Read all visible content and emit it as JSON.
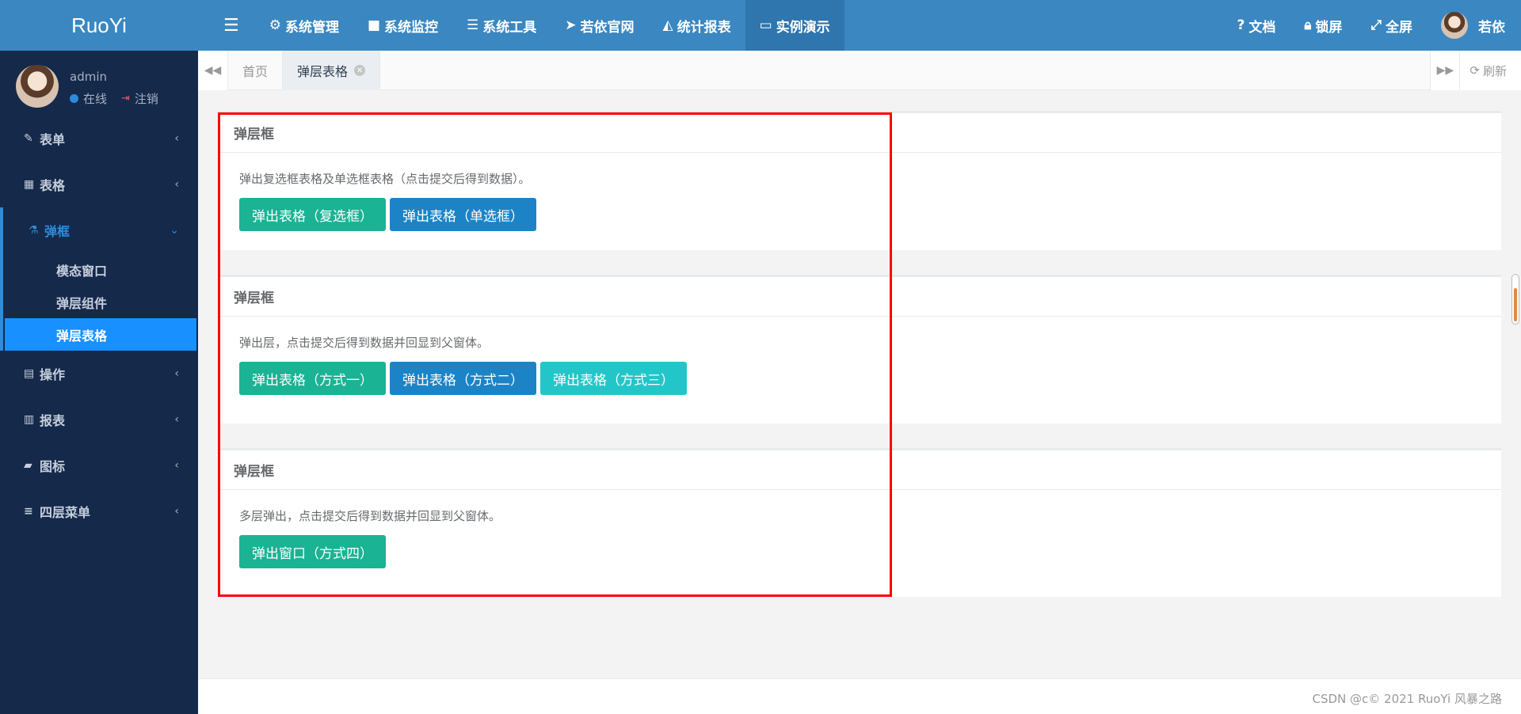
{
  "app": {
    "logo": "RuoYi"
  },
  "user": {
    "name": "admin",
    "status": "在线",
    "logout": "注销"
  },
  "sidebar": {
    "items": [
      {
        "label": "表单",
        "icon": "edit-icon",
        "glyph": "✎"
      },
      {
        "label": "表格",
        "icon": "table-icon",
        "glyph": "▦"
      },
      {
        "label": "弹框",
        "icon": "flask-icon",
        "glyph": "⚗"
      },
      {
        "label": "操作",
        "icon": "calendar-icon",
        "glyph": "▤"
      },
      {
        "label": "报表",
        "icon": "bar-chart-icon",
        "glyph": "▥"
      },
      {
        "label": "图标",
        "icon": "book-icon",
        "glyph": "▰"
      },
      {
        "label": "四层菜单",
        "icon": "list-icon",
        "glyph": "≡"
      }
    ],
    "submenu": [
      "模态窗口",
      "弹层组件",
      "弹层表格"
    ]
  },
  "topnav": {
    "items": [
      {
        "label": "系统管理",
        "icon": "gear-icon",
        "glyph": "⚙"
      },
      {
        "label": "系统监控",
        "icon": "video-icon",
        "glyph": "■"
      },
      {
        "label": "系统工具",
        "icon": "bars-icon",
        "glyph": "☰"
      },
      {
        "label": "若依官网",
        "icon": "location-arrow-icon",
        "glyph": "➤"
      },
      {
        "label": "统计报表",
        "icon": "area-chart-icon",
        "glyph": "◭"
      },
      {
        "label": "实例演示",
        "icon": "desktop-icon",
        "glyph": "▭"
      }
    ],
    "right": {
      "docs": "文档",
      "lock": "锁屏",
      "fullscreen": "全屏",
      "username": "若依"
    }
  },
  "tabs": {
    "items": [
      "首页",
      "弹层表格"
    ],
    "refresh": "刷新"
  },
  "panels": [
    {
      "title": "弹层框",
      "desc": "弹出复选框表格及单选框表格（点击提交后得到数据）。",
      "buttons": [
        "弹出表格（复选框）",
        "弹出表格（单选框）"
      ]
    },
    {
      "title": "弹层框",
      "desc": "弹出层，点击提交后得到数据并回显到父窗体。",
      "buttons": [
        "弹出表格（方式一）",
        "弹出表格（方式二）",
        "弹出表格（方式三）"
      ]
    },
    {
      "title": "弹层框",
      "desc": "多层弹出，点击提交后得到数据并回显到父窗体。",
      "buttons": [
        "弹出窗口（方式四）"
      ]
    }
  ],
  "footer": {
    "watermark": "CSDN @c© 2021 RuoYi 风暴之路"
  },
  "colors": {
    "sidebar_bg": "#15294a",
    "topbar_bg": "#3a87c1",
    "active_blue": "#1890ff",
    "btn_green": "#1ab394",
    "btn_blue": "#1c84c6",
    "btn_cyan": "#23c6c8",
    "highlight_red": "#ff0000"
  }
}
